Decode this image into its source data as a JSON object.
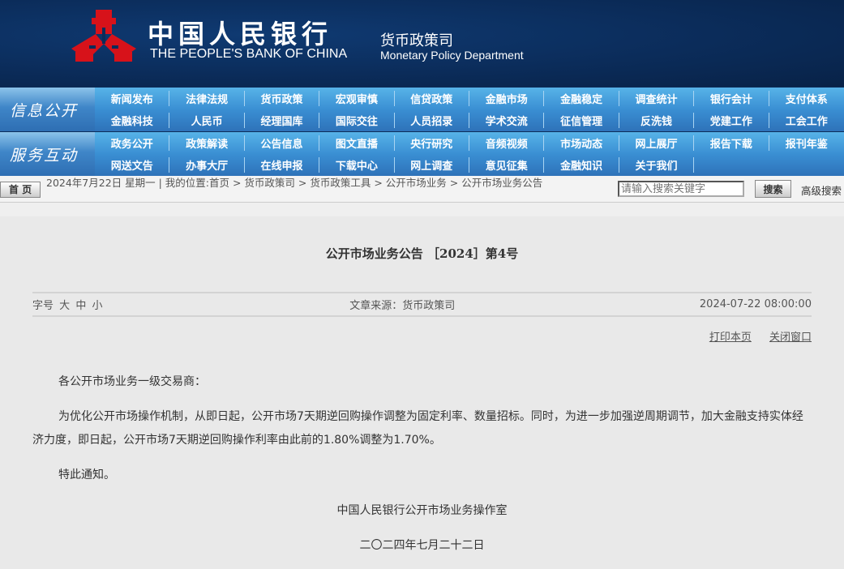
{
  "header": {
    "bank_cn": "中国人民银行",
    "bank_en": "THE PEOPLE'S BANK OF CHINA",
    "dept_cn": "货币政策司",
    "dept_en": "Monetary Policy Department"
  },
  "nav": [
    {
      "label": "信息公开",
      "items": [
        "新闻发布",
        "法律法规",
        "货币政策",
        "宏观审慎",
        "信贷政策",
        "金融市场",
        "金融稳定",
        "调查统计",
        "银行会计",
        "支付体系",
        "金融科技",
        "人民币",
        "经理国库",
        "国际交往",
        "人员招录",
        "学术交流",
        "征信管理",
        "反洗钱",
        "党建工作",
        "工会工作"
      ]
    },
    {
      "label": "服务互动",
      "items": [
        "政务公开",
        "政策解读",
        "公告信息",
        "图文直播",
        "央行研究",
        "音频视频",
        "市场动态",
        "网上展厅",
        "报告下载",
        "报刊年鉴",
        "网送文告",
        "办事大厅",
        "在线申报",
        "下载中心",
        "网上调查",
        "意见征集",
        "金融知识",
        "关于我们",
        "",
        ""
      ]
    }
  ],
  "crumb": {
    "home": "首 页",
    "text": "2024年7月22日 星期一 | 我的位置:首页 > 货币政策司 > 货币政策工具 > 公开市场业务 > 公开市场业务公告",
    "search_placeholder": "请输入搜索关键字",
    "search_btn": "搜索",
    "advanced": "高级搜索"
  },
  "article": {
    "title": "公开市场业务公告 ［2024］第4号",
    "font_label": "字号",
    "font_sizes": [
      "大",
      "中",
      "小"
    ],
    "source": "文章来源：货币政策司",
    "datetime": "2024-07-22 08:00:00",
    "print": "打印本页",
    "close": "关闭窗口",
    "greeting": "各公开市场业务一级交易商：",
    "body": "为优化公开市场操作机制，从即日起，公开市场7天期逆回购操作调整为固定利率、数量招标。同时，为进一步加强逆周期调节，加大金融支持实体经济力度，即日起，公开市场7天期逆回购操作利率由此前的1.80%调整为1.70%。",
    "notice": "特此通知。",
    "signature": "中国人民银行公开市场业务操作室",
    "date": "二〇二四年七月二十二日"
  }
}
